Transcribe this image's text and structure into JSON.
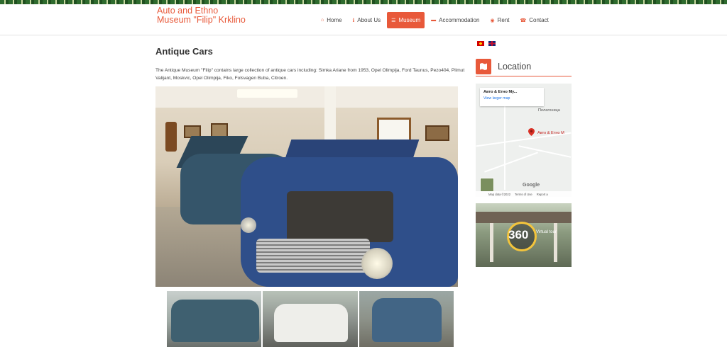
{
  "site": {
    "logo_line1": "Auto and Ethno",
    "logo_line2": "Museum \"Filip\" Krklino",
    "brand_color": "#e8593a"
  },
  "nav": {
    "items": [
      {
        "label": "Home",
        "icon": "home-icon"
      },
      {
        "label": "About Us",
        "icon": "info-icon"
      },
      {
        "label": "Museum",
        "icon": "museum-icon",
        "active": true
      },
      {
        "label": "Accommodation",
        "icon": "bed-icon"
      },
      {
        "label": "Rent",
        "icon": "car-icon"
      },
      {
        "label": "Contact",
        "icon": "phone-icon"
      }
    ]
  },
  "main": {
    "title": "Antique Cars",
    "intro": "The Antique Museum \"Filip\" contains large collection of antique cars including: Simka Ariane from 1953, Opel Olimpija, Ford Taunus, Pezo404, Plimut Valijant, Moskvic, Opel Olimpija, Fiko, Folsvagen Buba, Citroen."
  },
  "sidebar": {
    "languages": [
      "mk-flag",
      "en-flag"
    ],
    "location_title": "Location",
    "map": {
      "place_name": "Авто & Етно Му...",
      "view_larger": "View larger map",
      "town": "Пелагоница",
      "pin_label": "Авто & Етно М",
      "google_logo": "Google",
      "footer": [
        "Map data ©2022",
        "Terms of Use",
        "Report a"
      ]
    },
    "tour": {
      "number": "360",
      "text": "Virtual tour"
    }
  }
}
